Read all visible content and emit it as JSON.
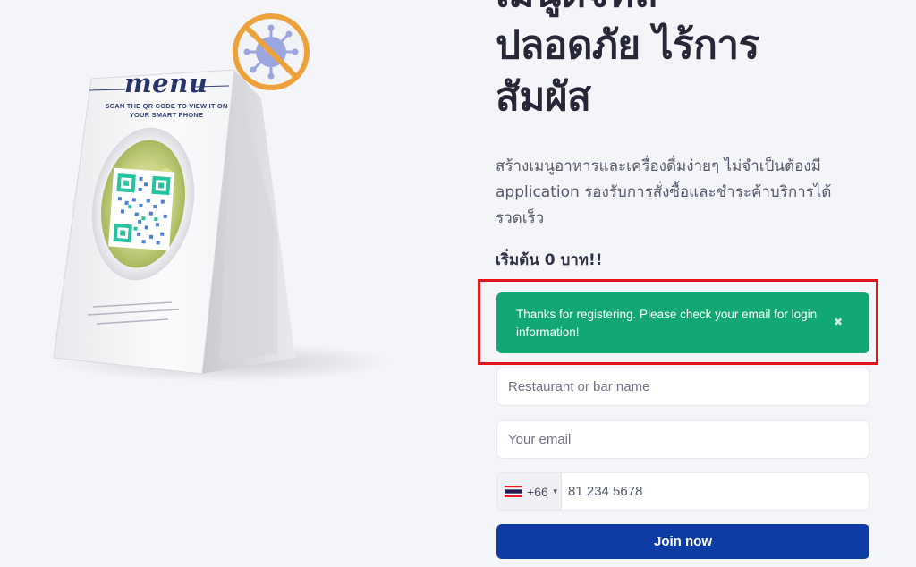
{
  "illustration": {
    "menu_title": "menu",
    "menu_scan_text": "SCAN THE QR CODE TO VIEW IT ON YOUR SMART PHONE",
    "no_virus_icon": "no-virus-icon"
  },
  "hero": {
    "headline_line1": "เมนูดิจิทัล",
    "headline_line2": "ปลอดภัย ไร้การ",
    "headline_line3": "สัมผัส",
    "subtitle": "สร้างเมนูอาหารและเครื่องดื่มง่ายๆ ไม่จำเป็นต้องมี application รองรับการสั่งซื้อและชำระค้าบริการได้รวดเร็ว",
    "price": "เริ่มต้น 0 บาท!!"
  },
  "form": {
    "alert_message": "Thanks for registering. Please check your email for login information!",
    "alert_close_icon": "close-icon",
    "restaurant_placeholder": "Restaurant or bar name",
    "email_placeholder": "Your email",
    "country_code": "+66",
    "phone_placeholder": "81 234 5678",
    "join_label": "Join now"
  },
  "colors": {
    "alert_bg": "#12a874",
    "highlight_border": "#e1151b",
    "button_bg": "#0e3ca5"
  }
}
